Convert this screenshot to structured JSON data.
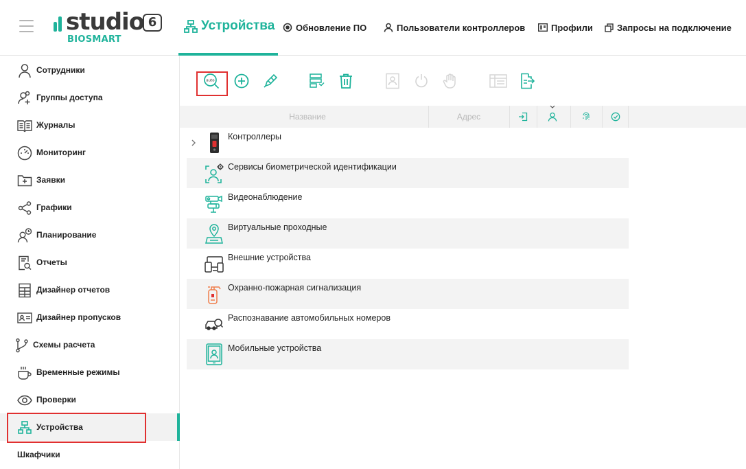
{
  "header": {
    "logo_word": "studio",
    "logo_version": "6",
    "logo_sub": "BIOSMART",
    "active_tab": "Устройства",
    "tabs": [
      {
        "label": "Обновление ПО",
        "icon": "update-icon"
      },
      {
        "label": "Пользователи контроллеров",
        "icon": "user-icon"
      },
      {
        "label": "Профили",
        "icon": "id-card-icon"
      },
      {
        "label": "Запросы на подключение",
        "icon": "connection-request-icon"
      }
    ]
  },
  "sidebar": {
    "items": [
      {
        "label": "Сотрудники",
        "icon": "person-icon"
      },
      {
        "label": "Группы доступа",
        "icon": "group-add-icon"
      },
      {
        "label": "Журналы",
        "icon": "book-icon"
      },
      {
        "label": "Мониторинг",
        "icon": "gauge-icon"
      },
      {
        "label": "Заявки",
        "icon": "folder-plus-icon"
      },
      {
        "label": "Графики",
        "icon": "share-icon"
      },
      {
        "label": "Планирование",
        "icon": "person-clock-icon"
      },
      {
        "label": "Отчеты",
        "icon": "report-search-icon"
      },
      {
        "label": "Дизайнер отчетов",
        "icon": "report-design-icon"
      },
      {
        "label": "Дизайнер пропусков",
        "icon": "badge-icon"
      },
      {
        "label": "Схемы расчета",
        "icon": "branch-icon"
      },
      {
        "label": "Временные режимы",
        "icon": "coffee-icon"
      },
      {
        "label": "Проверки",
        "icon": "eye-icon"
      },
      {
        "label": "Устройства",
        "icon": "devices-network-icon"
      },
      {
        "label": "Шкафчики",
        "icon": "locker-icon"
      }
    ],
    "active_index": 13
  },
  "toolbar": {
    "auto_search_label": "auto",
    "buttons": [
      "auto-search-icon",
      "add-icon",
      "edit-pen-icon",
      "settings-list-icon",
      "trash-icon",
      "user-card-icon",
      "power-icon",
      "hand-icon",
      "table-icon",
      "export-icon"
    ]
  },
  "grid": {
    "col_name": "Название",
    "col_address": "Адрес",
    "header_icons": [
      "login-icon",
      "person-icon",
      "fingerprint-icon",
      "check-circle-icon"
    ]
  },
  "rows": [
    {
      "label": "Контроллеры",
      "icon": "controller-icon",
      "expandable": true
    },
    {
      "label": "Сервисы биометрической идентификации",
      "icon": "face-id-gear-icon"
    },
    {
      "label": "Видеонаблюдение",
      "icon": "cctv-camera-icon"
    },
    {
      "label": "Виртуальные проходные",
      "icon": "virtual-checkpoint-icon"
    },
    {
      "label": "Внешние устройства",
      "icon": "external-devices-icon"
    },
    {
      "label": "Охранно-пожарная сигнализация",
      "icon": "fire-extinguisher-icon"
    },
    {
      "label": "Распознавание автомобильных номеров",
      "icon": "car-search-icon"
    },
    {
      "label": "Мобильные устройства",
      "icon": "mobile-face-icon"
    }
  ],
  "colors": {
    "accent": "#1fb39b",
    "highlight": "#e03030",
    "fire": "#f07d4a"
  }
}
